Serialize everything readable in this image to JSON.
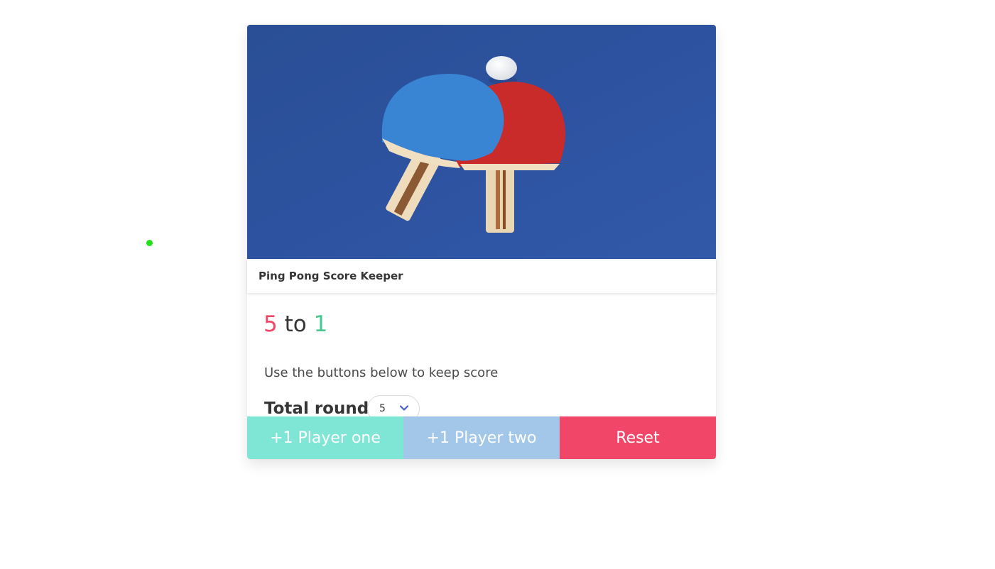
{
  "card": {
    "image_alt": "ping-pong-paddles-photo",
    "title": "Ping Pong Score Keeper"
  },
  "score": {
    "player_one": "5",
    "separator": "to",
    "player_two": "1"
  },
  "subtitle": "Use the buttons below to keep score",
  "rounds": {
    "label": "Total rounds",
    "selected": "5"
  },
  "buttons": {
    "player_one": "+1 Player one",
    "player_two": "+1 Player two",
    "reset": "Reset"
  },
  "colors": {
    "player_one": "#f14668",
    "player_two": "#48c78e",
    "btn_one": "#7fe6d6",
    "btn_two": "#a2c7e8",
    "btn_reset": "#f14668",
    "cursor": "#22e01a"
  },
  "icons": {
    "select_arrow": "chevron-down-icon"
  }
}
